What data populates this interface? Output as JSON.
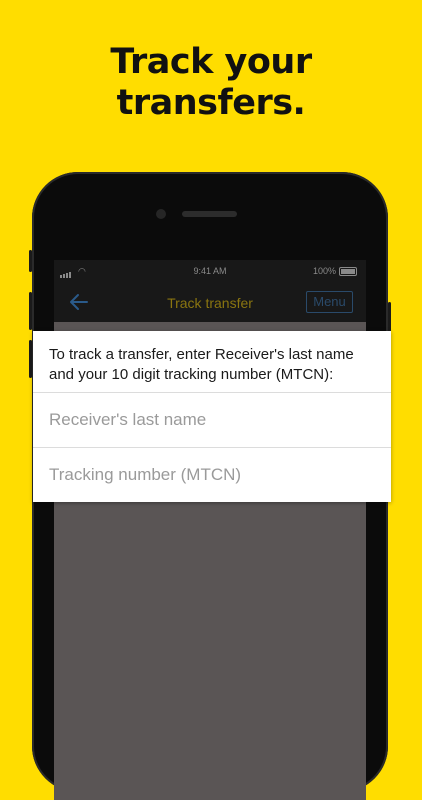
{
  "headline": {
    "line1": "Track your",
    "line2": "transfers."
  },
  "status_bar": {
    "time": "9:41 AM",
    "battery": "100%"
  },
  "nav": {
    "title": "Track transfer",
    "menu_label": "Menu"
  },
  "form": {
    "instruction_line1": "To track a transfer, enter Receiver's last name",
    "instruction_line2": "and your 10 digit tracking number (MTCN):",
    "last_name_placeholder": "Receiver's last name",
    "mtcn_placeholder": "Tracking number (MTCN)"
  },
  "icons": {
    "back": "back-arrow-icon",
    "signal": "signal-icon",
    "wifi": "wifi-icon",
    "battery": "battery-icon"
  },
  "colors": {
    "background": "#FFDD00",
    "brand": "#FFDD00",
    "accent_blue": "#2a5a8a"
  }
}
